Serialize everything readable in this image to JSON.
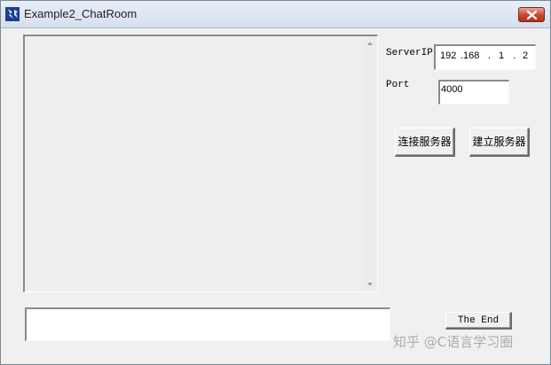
{
  "window": {
    "title": "Example2_ChatRoom",
    "close_glyph": "✕"
  },
  "form": {
    "server_ip_label": "ServerIP",
    "server_ip_parts": [
      "192",
      ".168",
      ".",
      "1",
      ".",
      "2"
    ],
    "port_label": "Port",
    "port_value": "4000",
    "connect_button": "连接服务器",
    "create_server_button": "建立服务器",
    "end_button": "The End"
  },
  "chat": {
    "log_text": "",
    "input_value": ""
  },
  "watermark": {
    "text": "知乎 @C语言学习圈"
  },
  "colors": {
    "window_bg": "#f0f0f0",
    "close_red": "#c9452f"
  },
  "icons": {
    "app": "app-icon",
    "close": "close-icon",
    "scroll_up": "scroll-up-arrow-icon",
    "scroll_down": "scroll-down-arrow-icon"
  }
}
